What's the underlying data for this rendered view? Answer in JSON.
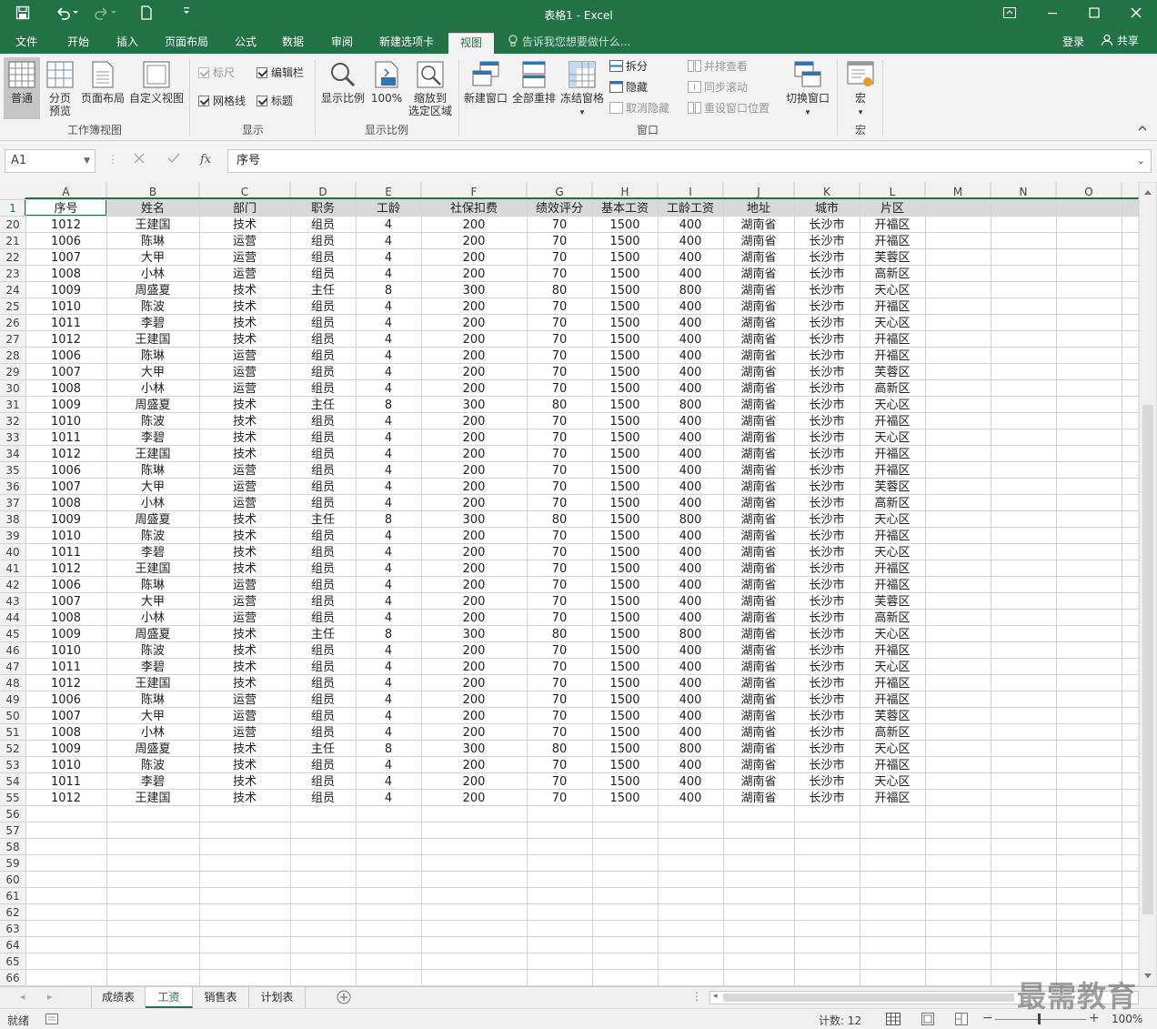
{
  "window": {
    "title": "表格1 - Excel"
  },
  "menu": {
    "tabs": [
      "文件",
      "开始",
      "插入",
      "页面布局",
      "公式",
      "数据",
      "审阅",
      "新建选项卡",
      "视图"
    ],
    "tell_me": "告诉我您想要做什么...",
    "login": "登录",
    "share": "共享"
  },
  "ribbon": {
    "normal": "普通",
    "page_break_1": "分页",
    "page_break_2": "预览",
    "page_layout": "页面布局",
    "custom_view": "自定义视图",
    "group_workbook_views": "工作簿视图",
    "ruler": "标尺",
    "formula_bar": "编辑栏",
    "gridlines": "网格线",
    "headings": "标题",
    "group_show": "显示",
    "zoom": "显示比例",
    "zoom_100": "100%",
    "zoom_sel_1": "缩放到",
    "zoom_sel_2": "选定区域",
    "group_zoom": "显示比例",
    "new_window": "新建窗口",
    "arrange_all": "全部重排",
    "freeze": "冻结窗格",
    "split": "拆分",
    "hide": "隐藏",
    "unhide": "取消隐藏",
    "side_by_side": "并排查看",
    "sync_scroll": "同步滚动",
    "reset_pos": "重设窗口位置",
    "switch_windows": "切换窗口",
    "group_window": "窗口",
    "macros": "宏",
    "group_macros": "宏"
  },
  "formula": {
    "name_box": "A1",
    "fx": "fx",
    "content": "序号"
  },
  "columns": [
    "A",
    "B",
    "C",
    "D",
    "E",
    "F",
    "G",
    "H",
    "I",
    "J",
    "K",
    "L",
    "M",
    "N",
    "O"
  ],
  "header_row": {
    "num": "1",
    "cells": [
      "序号",
      "姓名",
      "部门",
      "职务",
      "工龄",
      "社保扣费",
      "绩效评分",
      "基本工资",
      "工龄工资",
      "地址",
      "城市",
      "片区"
    ]
  },
  "rows": [
    {
      "n": "20",
      "c": [
        "1012",
        "王建国",
        "技术",
        "组员",
        "4",
        "200",
        "70",
        "1500",
        "400",
        "湖南省",
        "长沙市",
        "开福区"
      ]
    },
    {
      "n": "21",
      "c": [
        "1006",
        "陈琳",
        "运营",
        "组员",
        "4",
        "200",
        "70",
        "1500",
        "400",
        "湖南省",
        "长沙市",
        "开福区"
      ]
    },
    {
      "n": "22",
      "c": [
        "1007",
        "大甲",
        "运营",
        "组员",
        "4",
        "200",
        "70",
        "1500",
        "400",
        "湖南省",
        "长沙市",
        "芙蓉区"
      ]
    },
    {
      "n": "23",
      "c": [
        "1008",
        "小林",
        "运营",
        "组员",
        "4",
        "200",
        "70",
        "1500",
        "400",
        "湖南省",
        "长沙市",
        "高新区"
      ]
    },
    {
      "n": "24",
      "c": [
        "1009",
        "周盛夏",
        "技术",
        "主任",
        "8",
        "300",
        "80",
        "1500",
        "800",
        "湖南省",
        "长沙市",
        "天心区"
      ]
    },
    {
      "n": "25",
      "c": [
        "1010",
        "陈波",
        "技术",
        "组员",
        "4",
        "200",
        "70",
        "1500",
        "400",
        "湖南省",
        "长沙市",
        "开福区"
      ]
    },
    {
      "n": "26",
      "c": [
        "1011",
        "李碧",
        "技术",
        "组员",
        "4",
        "200",
        "70",
        "1500",
        "400",
        "湖南省",
        "长沙市",
        "天心区"
      ]
    },
    {
      "n": "27",
      "c": [
        "1012",
        "王建国",
        "技术",
        "组员",
        "4",
        "200",
        "70",
        "1500",
        "400",
        "湖南省",
        "长沙市",
        "开福区"
      ]
    },
    {
      "n": "28",
      "c": [
        "1006",
        "陈琳",
        "运营",
        "组员",
        "4",
        "200",
        "70",
        "1500",
        "400",
        "湖南省",
        "长沙市",
        "开福区"
      ]
    },
    {
      "n": "29",
      "c": [
        "1007",
        "大甲",
        "运营",
        "组员",
        "4",
        "200",
        "70",
        "1500",
        "400",
        "湖南省",
        "长沙市",
        "芙蓉区"
      ]
    },
    {
      "n": "30",
      "c": [
        "1008",
        "小林",
        "运营",
        "组员",
        "4",
        "200",
        "70",
        "1500",
        "400",
        "湖南省",
        "长沙市",
        "高新区"
      ]
    },
    {
      "n": "31",
      "c": [
        "1009",
        "周盛夏",
        "技术",
        "主任",
        "8",
        "300",
        "80",
        "1500",
        "800",
        "湖南省",
        "长沙市",
        "天心区"
      ]
    },
    {
      "n": "32",
      "c": [
        "1010",
        "陈波",
        "技术",
        "组员",
        "4",
        "200",
        "70",
        "1500",
        "400",
        "湖南省",
        "长沙市",
        "开福区"
      ]
    },
    {
      "n": "33",
      "c": [
        "1011",
        "李碧",
        "技术",
        "组员",
        "4",
        "200",
        "70",
        "1500",
        "400",
        "湖南省",
        "长沙市",
        "天心区"
      ]
    },
    {
      "n": "34",
      "c": [
        "1012",
        "王建国",
        "技术",
        "组员",
        "4",
        "200",
        "70",
        "1500",
        "400",
        "湖南省",
        "长沙市",
        "开福区"
      ]
    },
    {
      "n": "35",
      "c": [
        "1006",
        "陈琳",
        "运营",
        "组员",
        "4",
        "200",
        "70",
        "1500",
        "400",
        "湖南省",
        "长沙市",
        "开福区"
      ]
    },
    {
      "n": "36",
      "c": [
        "1007",
        "大甲",
        "运营",
        "组员",
        "4",
        "200",
        "70",
        "1500",
        "400",
        "湖南省",
        "长沙市",
        "芙蓉区"
      ]
    },
    {
      "n": "37",
      "c": [
        "1008",
        "小林",
        "运营",
        "组员",
        "4",
        "200",
        "70",
        "1500",
        "400",
        "湖南省",
        "长沙市",
        "高新区"
      ]
    },
    {
      "n": "38",
      "c": [
        "1009",
        "周盛夏",
        "技术",
        "主任",
        "8",
        "300",
        "80",
        "1500",
        "800",
        "湖南省",
        "长沙市",
        "天心区"
      ]
    },
    {
      "n": "39",
      "c": [
        "1010",
        "陈波",
        "技术",
        "组员",
        "4",
        "200",
        "70",
        "1500",
        "400",
        "湖南省",
        "长沙市",
        "开福区"
      ]
    },
    {
      "n": "40",
      "c": [
        "1011",
        "李碧",
        "技术",
        "组员",
        "4",
        "200",
        "70",
        "1500",
        "400",
        "湖南省",
        "长沙市",
        "天心区"
      ]
    },
    {
      "n": "41",
      "c": [
        "1012",
        "王建国",
        "技术",
        "组员",
        "4",
        "200",
        "70",
        "1500",
        "400",
        "湖南省",
        "长沙市",
        "开福区"
      ]
    },
    {
      "n": "42",
      "c": [
        "1006",
        "陈琳",
        "运营",
        "组员",
        "4",
        "200",
        "70",
        "1500",
        "400",
        "湖南省",
        "长沙市",
        "开福区"
      ]
    },
    {
      "n": "43",
      "c": [
        "1007",
        "大甲",
        "运营",
        "组员",
        "4",
        "200",
        "70",
        "1500",
        "400",
        "湖南省",
        "长沙市",
        "芙蓉区"
      ]
    },
    {
      "n": "44",
      "c": [
        "1008",
        "小林",
        "运营",
        "组员",
        "4",
        "200",
        "70",
        "1500",
        "400",
        "湖南省",
        "长沙市",
        "高新区"
      ]
    },
    {
      "n": "45",
      "c": [
        "1009",
        "周盛夏",
        "技术",
        "主任",
        "8",
        "300",
        "80",
        "1500",
        "800",
        "湖南省",
        "长沙市",
        "天心区"
      ]
    },
    {
      "n": "46",
      "c": [
        "1010",
        "陈波",
        "技术",
        "组员",
        "4",
        "200",
        "70",
        "1500",
        "400",
        "湖南省",
        "长沙市",
        "开福区"
      ]
    },
    {
      "n": "47",
      "c": [
        "1011",
        "李碧",
        "技术",
        "组员",
        "4",
        "200",
        "70",
        "1500",
        "400",
        "湖南省",
        "长沙市",
        "天心区"
      ]
    },
    {
      "n": "48",
      "c": [
        "1012",
        "王建国",
        "技术",
        "组员",
        "4",
        "200",
        "70",
        "1500",
        "400",
        "湖南省",
        "长沙市",
        "开福区"
      ]
    },
    {
      "n": "49",
      "c": [
        "1006",
        "陈琳",
        "运营",
        "组员",
        "4",
        "200",
        "70",
        "1500",
        "400",
        "湖南省",
        "长沙市",
        "开福区"
      ]
    },
    {
      "n": "50",
      "c": [
        "1007",
        "大甲",
        "运营",
        "组员",
        "4",
        "200",
        "70",
        "1500",
        "400",
        "湖南省",
        "长沙市",
        "芙蓉区"
      ]
    },
    {
      "n": "51",
      "c": [
        "1008",
        "小林",
        "运营",
        "组员",
        "4",
        "200",
        "70",
        "1500",
        "400",
        "湖南省",
        "长沙市",
        "高新区"
      ]
    },
    {
      "n": "52",
      "c": [
        "1009",
        "周盛夏",
        "技术",
        "主任",
        "8",
        "300",
        "80",
        "1500",
        "800",
        "湖南省",
        "长沙市",
        "天心区"
      ]
    },
    {
      "n": "53",
      "c": [
        "1010",
        "陈波",
        "技术",
        "组员",
        "4",
        "200",
        "70",
        "1500",
        "400",
        "湖南省",
        "长沙市",
        "开福区"
      ]
    },
    {
      "n": "54",
      "c": [
        "1011",
        "李碧",
        "技术",
        "组员",
        "4",
        "200",
        "70",
        "1500",
        "400",
        "湖南省",
        "长沙市",
        "天心区"
      ]
    },
    {
      "n": "55",
      "c": [
        "1012",
        "王建国",
        "技术",
        "组员",
        "4",
        "200",
        "70",
        "1500",
        "400",
        "湖南省",
        "长沙市",
        "开福区"
      ]
    },
    {
      "n": "56",
      "c": []
    },
    {
      "n": "57",
      "c": []
    },
    {
      "n": "58",
      "c": []
    },
    {
      "n": "59",
      "c": []
    },
    {
      "n": "60",
      "c": []
    },
    {
      "n": "61",
      "c": []
    },
    {
      "n": "62",
      "c": []
    },
    {
      "n": "63",
      "c": []
    },
    {
      "n": "64",
      "c": []
    },
    {
      "n": "65",
      "c": []
    },
    {
      "n": "66",
      "c": []
    }
  ],
  "sheets": [
    "成绩表",
    "工资",
    "销售表",
    "计划表"
  ],
  "active_sheet": "工资",
  "status": {
    "ready": "就绪",
    "count": "计数: 12",
    "zoom": "100%"
  },
  "watermark": "最需教育",
  "colors": {
    "accent": "#217346",
    "header_fill": "#d9d9d9",
    "grid": "#d4d4d4"
  },
  "icons": [
    "save-icon",
    "undo-icon",
    "redo-icon",
    "new-file-icon",
    "customize-qa-icon",
    "ribbon-display-icon",
    "minimize-icon",
    "maximize-icon",
    "close-icon",
    "lightbulb-icon",
    "user-icon"
  ]
}
